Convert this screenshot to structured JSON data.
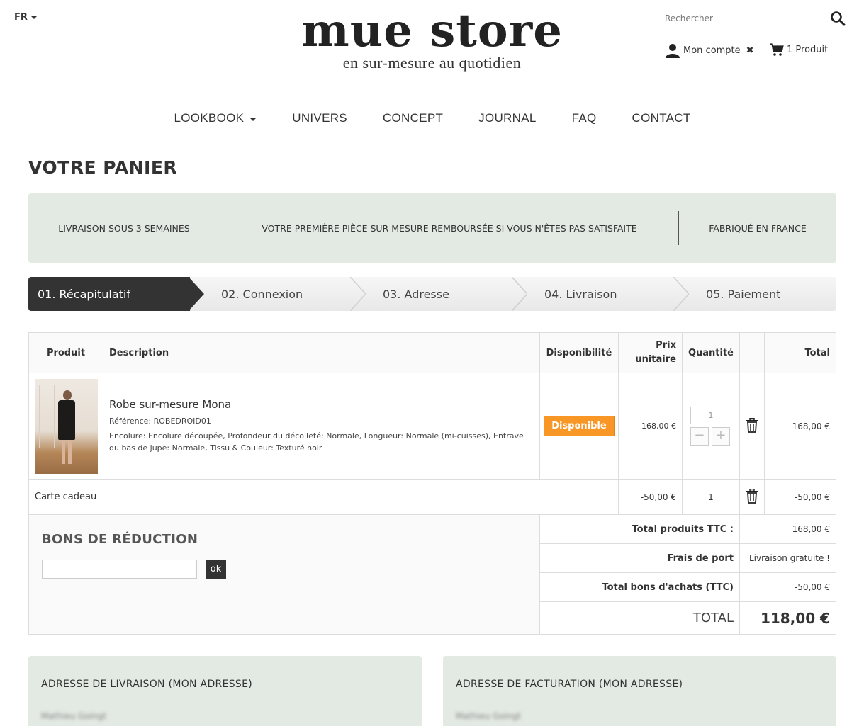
{
  "header": {
    "language": "FR",
    "logo_title": "mue store",
    "logo_tagline": "en sur-mesure au quotidien",
    "search_placeholder": "Rechercher",
    "account_label": "Mon compte",
    "cart_label": "1 Produit"
  },
  "nav": {
    "items": [
      {
        "label": "LOOKBOOK",
        "has_dropdown": true
      },
      {
        "label": "UNIVERS"
      },
      {
        "label": "CONCEPT"
      },
      {
        "label": "JOURNAL"
      },
      {
        "label": "FAQ"
      },
      {
        "label": "CONTACT"
      }
    ]
  },
  "page_title": "VOTRE PANIER",
  "reassurance": [
    "LIVRAISON SOUS 3 SEMAINES",
    "VOTRE PREMIÈRE PIÈCE SUR-MESURE REMBOURSÉE SI VOUS N'ÊTES PAS SATISFAITE",
    "FABRIQUÉ EN FRANCE"
  ],
  "steps": [
    {
      "label": "01. Récapitulatif",
      "active": true
    },
    {
      "label": "02. Connexion",
      "active": false
    },
    {
      "label": "03. Adresse",
      "active": false
    },
    {
      "label": "04. Livraison",
      "active": false
    },
    {
      "label": "05. Paiement",
      "active": false
    }
  ],
  "cart": {
    "headers": {
      "product": "Produit",
      "description": "Description",
      "availability": "Disponibilité",
      "unit_price_line1": "Prix",
      "unit_price_line2": "unitaire",
      "quantity": "Quantité",
      "total": "Total"
    },
    "product": {
      "name": "Robe sur-mesure Mona",
      "reference": "Référence: ROBEDROID01",
      "attributes": "Encolure: Encolure découpée, Profondeur du décolleté: Normale, Longueur: Normale (mi-cuisses), Entrave du bas de jupe: Normale, Tissu & Couleur: Texturé noir",
      "availability": "Disponible",
      "unit_price": "168,00 €",
      "quantity": "1",
      "total": "168,00 €"
    },
    "gift": {
      "label": "Carte cadeau",
      "unit_price": "-50,00 €",
      "quantity": "1",
      "total": "-50,00 €"
    },
    "voucher": {
      "title": "BONS DE RÉDUCTION",
      "input_value": "",
      "button_label": "ok"
    },
    "summary": {
      "products_label": "Total produits TTC :",
      "products_value": "168,00 €",
      "shipping_label": "Frais de port",
      "shipping_value": "Livraison gratuite !",
      "vouchers_label": "Total bons d'achats (TTC)",
      "vouchers_value": "-50,00 €",
      "total_label": "TOTAL",
      "total_value": "118,00 €"
    }
  },
  "addresses": {
    "delivery_title": "ADRESSE DE LIVRAISON (MON ADRESSE)",
    "delivery_name": "Mathieu Goingt",
    "billing_title": "ADRESSE DE FACTURATION (MON ADRESSE)",
    "billing_name": "Mathieu Goingt"
  },
  "colors": {
    "accent_dark": "#333333",
    "reassurance_bg": "#e3e9e3",
    "available_badge": "#f89626"
  }
}
